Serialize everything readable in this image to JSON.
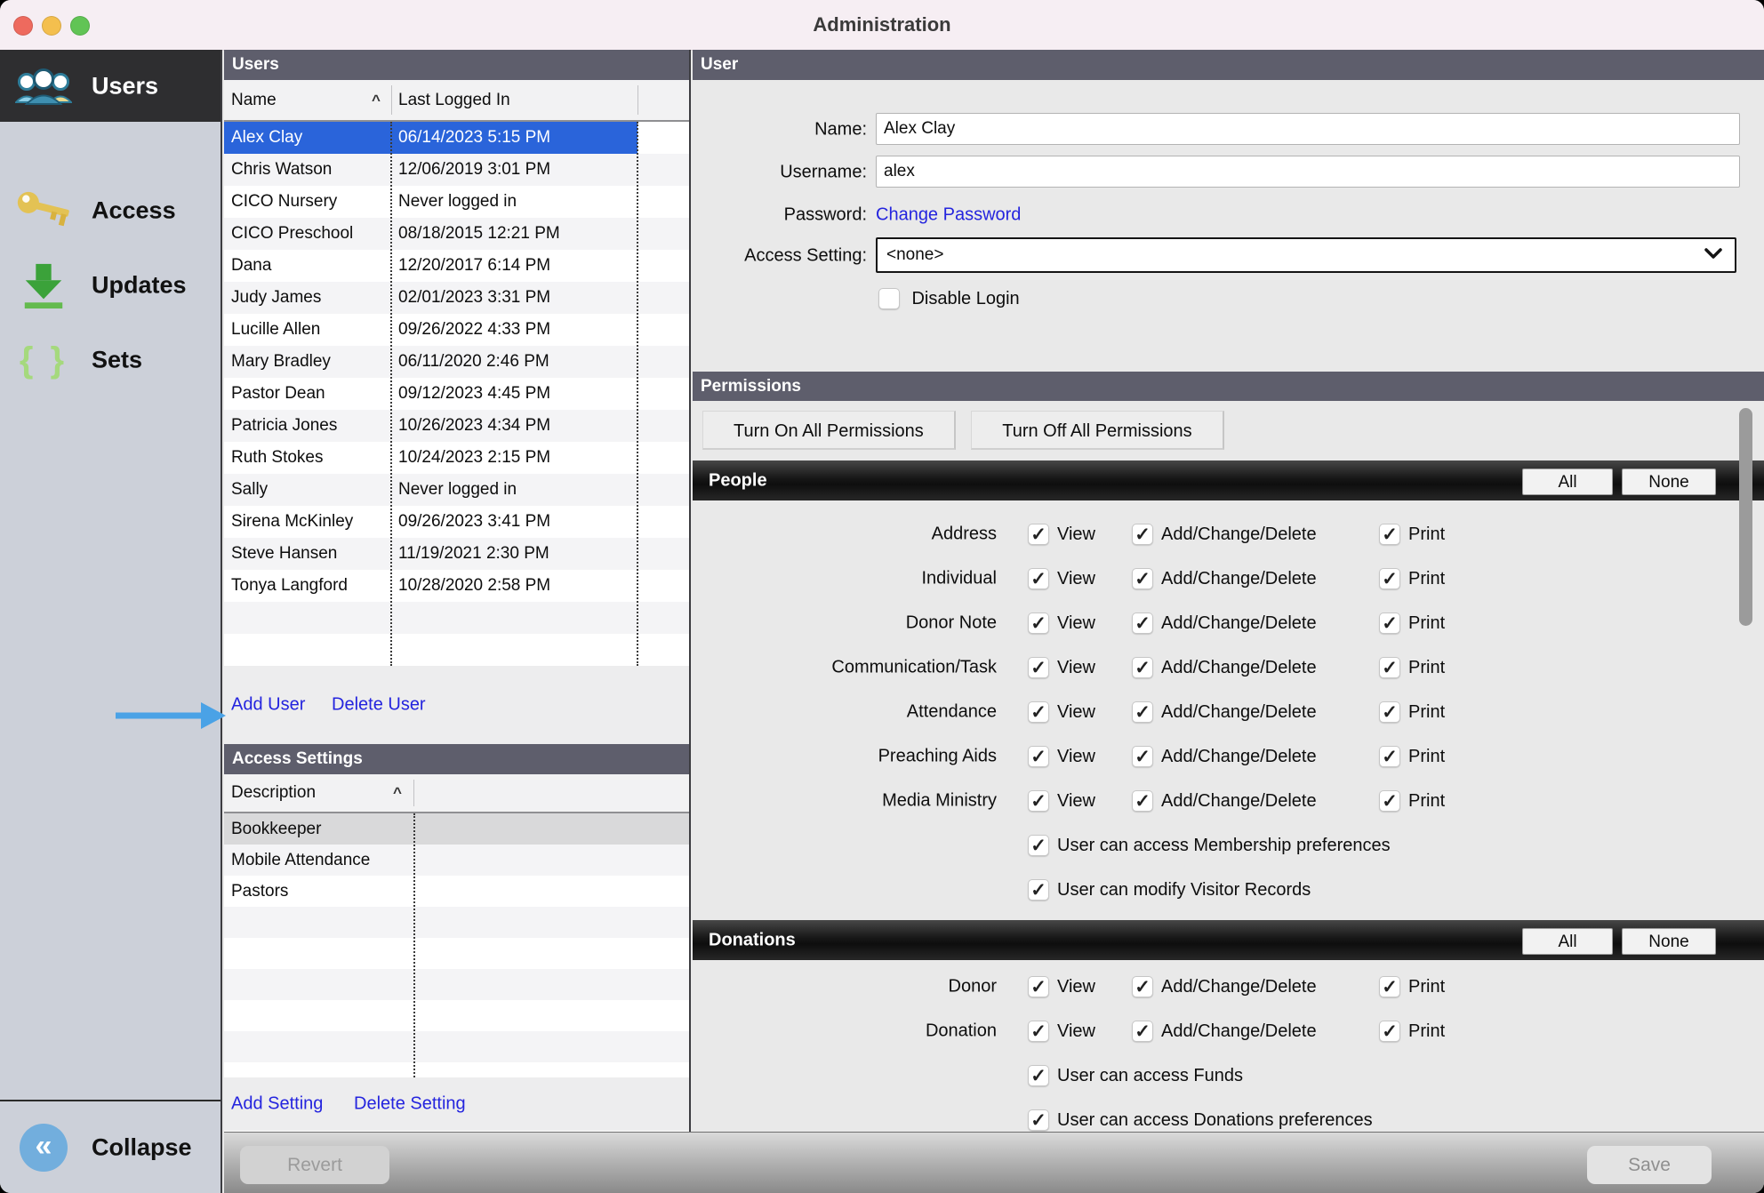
{
  "window": {
    "title": "Administration"
  },
  "titlebar": {
    "buttons": [
      "close-icon",
      "minimize-icon",
      "zoom-icon"
    ]
  },
  "sidebar": {
    "items": [
      {
        "label": "Users",
        "icon": "users-group-icon",
        "selected": true
      },
      {
        "label": "Access",
        "icon": "key-icon",
        "selected": false
      },
      {
        "label": "Updates",
        "icon": "download-icon",
        "selected": false
      },
      {
        "label": "Sets",
        "icon": "braces-icon",
        "selected": false
      }
    ],
    "braces_glyph": "{ }",
    "collapse": {
      "label": "Collapse",
      "icon": "collapse-chevrons-icon",
      "glyph": "«"
    }
  },
  "users_panel": {
    "title": "Users",
    "columns": {
      "name": "Name",
      "last_logged_in": "Last Logged In"
    },
    "sort_indicator": "^",
    "selected_row": "Alex Clay",
    "rows": [
      {
        "name": "Alex Clay",
        "last_logged_in": "06/14/2023 5:15 PM"
      },
      {
        "name": "Chris Watson",
        "last_logged_in": "12/06/2019 3:01 PM"
      },
      {
        "name": "CICO Nursery",
        "last_logged_in": "Never logged in"
      },
      {
        "name": "CICO Preschool",
        "last_logged_in": "08/18/2015 12:21 PM"
      },
      {
        "name": "Dana",
        "last_logged_in": "12/20/2017 6:14 PM"
      },
      {
        "name": "Judy James",
        "last_logged_in": "02/01/2023 3:31 PM"
      },
      {
        "name": "Lucille Allen",
        "last_logged_in": "09/26/2022 4:33 PM"
      },
      {
        "name": "Mary Bradley",
        "last_logged_in": "06/11/2020 2:46 PM"
      },
      {
        "name": "Pastor Dean",
        "last_logged_in": "09/12/2023 4:45 PM"
      },
      {
        "name": "Patricia Jones",
        "last_logged_in": "10/26/2023 4:34 PM"
      },
      {
        "name": "Ruth Stokes",
        "last_logged_in": "10/24/2023 2:15 PM"
      },
      {
        "name": "Sally",
        "last_logged_in": "Never logged in"
      },
      {
        "name": "Sirena McKinley",
        "last_logged_in": "09/26/2023 3:41 PM"
      },
      {
        "name": "Steve Hansen",
        "last_logged_in": "11/19/2021 2:30 PM"
      },
      {
        "name": "Tonya Langford",
        "last_logged_in": "10/28/2020 2:58 PM"
      }
    ],
    "add_link": "Add User",
    "delete_link": "Delete User"
  },
  "access_settings_panel": {
    "title": "Access Settings",
    "columns": {
      "description": "Description"
    },
    "sort_indicator": "^",
    "selected_row": "Bookkeeper",
    "rows": [
      "Bookkeeper",
      "Mobile Attendance",
      "Pastors"
    ],
    "add_link": "Add Setting",
    "delete_link": "Delete Setting"
  },
  "user_panel": {
    "title": "User",
    "name_label": "Name:",
    "name_value": "Alex Clay",
    "username_label": "Username:",
    "username_value": "alex",
    "password_label": "Password:",
    "change_password_link": "Change Password",
    "access_setting_label": "Access Setting:",
    "access_setting_value": "<none>",
    "disable_login_label": "Disable Login",
    "disable_login_checked": false
  },
  "permissions_panel": {
    "title": "Permissions",
    "turn_on_button": "Turn On All Permissions",
    "turn_off_button": "Turn Off All Permissions",
    "checkbox_labels": {
      "view": "View",
      "acd": "Add/Change/Delete",
      "print": "Print"
    },
    "all_button": "All",
    "none_button": "None",
    "check_glyph": "✓",
    "sections": [
      {
        "title": "People",
        "rows": [
          {
            "category": "Address",
            "view": true,
            "acd": true,
            "print": true
          },
          {
            "category": "Individual",
            "view": true,
            "acd": true,
            "print": true
          },
          {
            "category": "Donor Note",
            "view": true,
            "acd": true,
            "print": true
          },
          {
            "category": "Communication/Task",
            "view": true,
            "acd": true,
            "print": true
          },
          {
            "category": "Attendance",
            "view": true,
            "acd": true,
            "print": true
          },
          {
            "category": "Preaching Aids",
            "view": true,
            "acd": true,
            "print": true
          },
          {
            "category": "Media Ministry",
            "view": true,
            "acd": true,
            "print": true
          }
        ],
        "extras": [
          {
            "label": "User can access Membership preferences",
            "checked": true
          },
          {
            "label": "User can modify Visitor Records",
            "checked": true
          }
        ]
      },
      {
        "title": "Donations",
        "rows": [
          {
            "category": "Donor",
            "view": true,
            "acd": true,
            "print": true
          },
          {
            "category": "Donation",
            "view": true,
            "acd": true,
            "print": true
          }
        ],
        "extras": [
          {
            "label": "User can access Funds",
            "checked": true
          },
          {
            "label": "User can access Donations preferences",
            "checked": true
          }
        ]
      }
    ]
  },
  "footer": {
    "revert_button": "Revert",
    "save_button": "Save"
  },
  "colors": {
    "accent_link": "#2424de",
    "selection_blue": "#2a64da",
    "panel_header": "#5e5e6c",
    "arrow_blue": "#4aa2e6",
    "traffic_red": "#ee6a5e",
    "traffic_yellow": "#f4bf4e",
    "traffic_green": "#61c455"
  }
}
